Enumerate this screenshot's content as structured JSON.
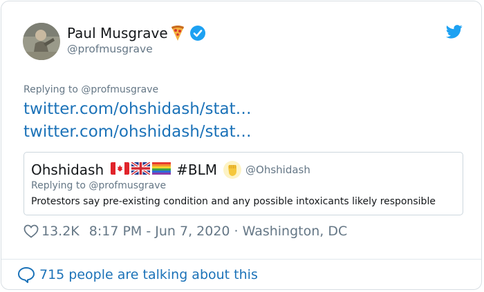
{
  "author": {
    "name": "Paul Musgrave",
    "handle": "@profmusgrave",
    "emoji": "pizza-icon",
    "verified_icon": "verified-badge-icon",
    "avatar": "profile-photo"
  },
  "platform_icon": "twitter-bird-icon",
  "reply": {
    "replying_to": "Replying to @profmusgrave"
  },
  "links": [
    "twitter.com/ohshidash/stat…",
    "twitter.com/ohshidash/stat…"
  ],
  "quoted_tweet": {
    "name": "Ohshidash",
    "flags": [
      "canada-flag-icon",
      "uk-flag-icon",
      "rainbow-flag-icon"
    ],
    "hashtag": "#BLM",
    "fist_icon": "raised-fist-icon",
    "handle": "@Ohshidash",
    "replying_to": "Replying to @profmusgrave",
    "text": "Protestors say pre-existing condition and any possible intoxicants likely responsible"
  },
  "meta": {
    "likes": "13.2K",
    "timestamp": "8:17 PM - Jun 7, 2020 · Washington, DC"
  },
  "footer": {
    "talking": "715 people are talking about this"
  },
  "colors": {
    "link": "#1b72b8",
    "muted": "#657786",
    "text": "#14171a",
    "twitter_blue": "#1da1f2"
  }
}
